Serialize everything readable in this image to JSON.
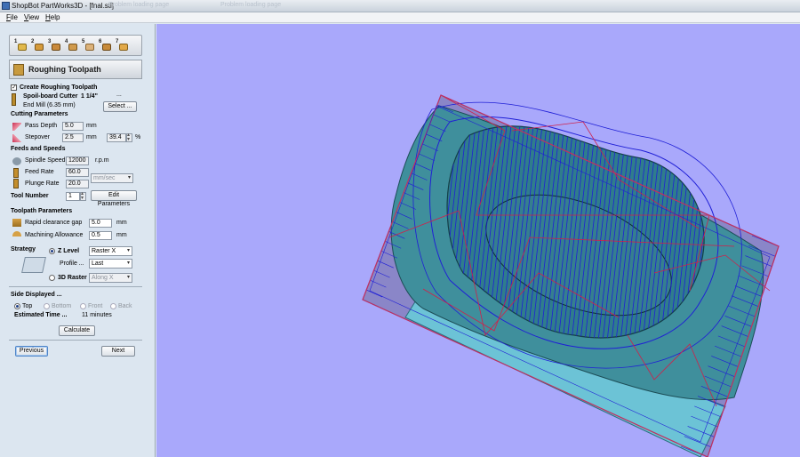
{
  "window": {
    "title": "ShopBot PartWorks3D - [fnal.stl]",
    "bg_tabs": [
      "Problem loading page",
      "Problem loading page"
    ]
  },
  "menu": [
    {
      "label": "File",
      "accel": "F",
      "rest": "ile"
    },
    {
      "label": "View",
      "accel": "V",
      "rest": "iew"
    },
    {
      "label": "Help",
      "accel": "H",
      "rest": "elp"
    }
  ],
  "toolbar": {
    "buttons": [
      {
        "num": "1",
        "icon": "model-icon"
      },
      {
        "num": "2",
        "icon": "material-icon"
      },
      {
        "num": "3",
        "icon": "toolpath-icon"
      },
      {
        "num": "4",
        "icon": "finish-icon"
      },
      {
        "num": "5",
        "icon": "cutout-icon"
      },
      {
        "num": "6",
        "icon": "preview-icon"
      },
      {
        "num": "7",
        "icon": "save-icon"
      }
    ]
  },
  "page": {
    "heading": "Roughing Toolpath"
  },
  "create": {
    "label": "Create Roughing Toolpath",
    "checked": true
  },
  "tool": {
    "name": "Spoil-board Cutter",
    "size": "1 1/4\"",
    "desc": "End Mill (6.35 mm)",
    "ellipsis": "...",
    "select_label": "Select ..."
  },
  "cutting": {
    "title": "Cutting Parameters",
    "pass_depth_label": "Pass Depth",
    "pass_depth": "5.0",
    "pass_depth_unit": "mm",
    "stepover_label": "Stepover",
    "stepover": "2.5",
    "stepover_unit": "mm",
    "stepover_pct": "39.4",
    "pct_sign": "%"
  },
  "feeds": {
    "title": "Feeds and Speeds",
    "spindle_label": "Spindle Speed",
    "spindle": "12000",
    "spindle_unit": "r.p.m",
    "feed_label": "Feed Rate",
    "feed": "60.0",
    "plunge_label": "Plunge Rate",
    "plunge": "20.0",
    "rate_unit": "mm/sec",
    "tool_number_label": "Tool Number",
    "tool_number": "1",
    "edit_label": "Edit Parameters"
  },
  "toolpath": {
    "title": "Toolpath Parameters",
    "rapid_label": "Rapid clearance gap",
    "rapid": "5.0",
    "rapid_unit": "mm",
    "allowance_label": "Machining Allowance",
    "allowance": "0.5",
    "allowance_unit": "mm"
  },
  "strategy": {
    "title": "Strategy",
    "z_level_label": "Z Level",
    "z_level_selected": true,
    "z_option": "Raster X",
    "profile_label": "Profile ...",
    "profile_option": "Last",
    "raster3d_label": "3D Raster",
    "raster3d_option": "Along X"
  },
  "side": {
    "title": "Side Displayed ...",
    "options": [
      "Top",
      "Bottom",
      "Front",
      "Back"
    ],
    "selected": "Top"
  },
  "estimate": {
    "label": "Estimated Time ...",
    "value": "11 minutes"
  },
  "buttons": {
    "calculate": "Calculate",
    "previous": "Previous",
    "next": "Next"
  },
  "colors": {
    "viewport_bg": "#a9a8fb",
    "model_fill": "#3f8f9c",
    "pocket_fill": "#2f7d8c",
    "toolpath_blue": "#1f1fd6",
    "rapid_red": "#d0204a",
    "base_block": "#6cc3d6"
  }
}
